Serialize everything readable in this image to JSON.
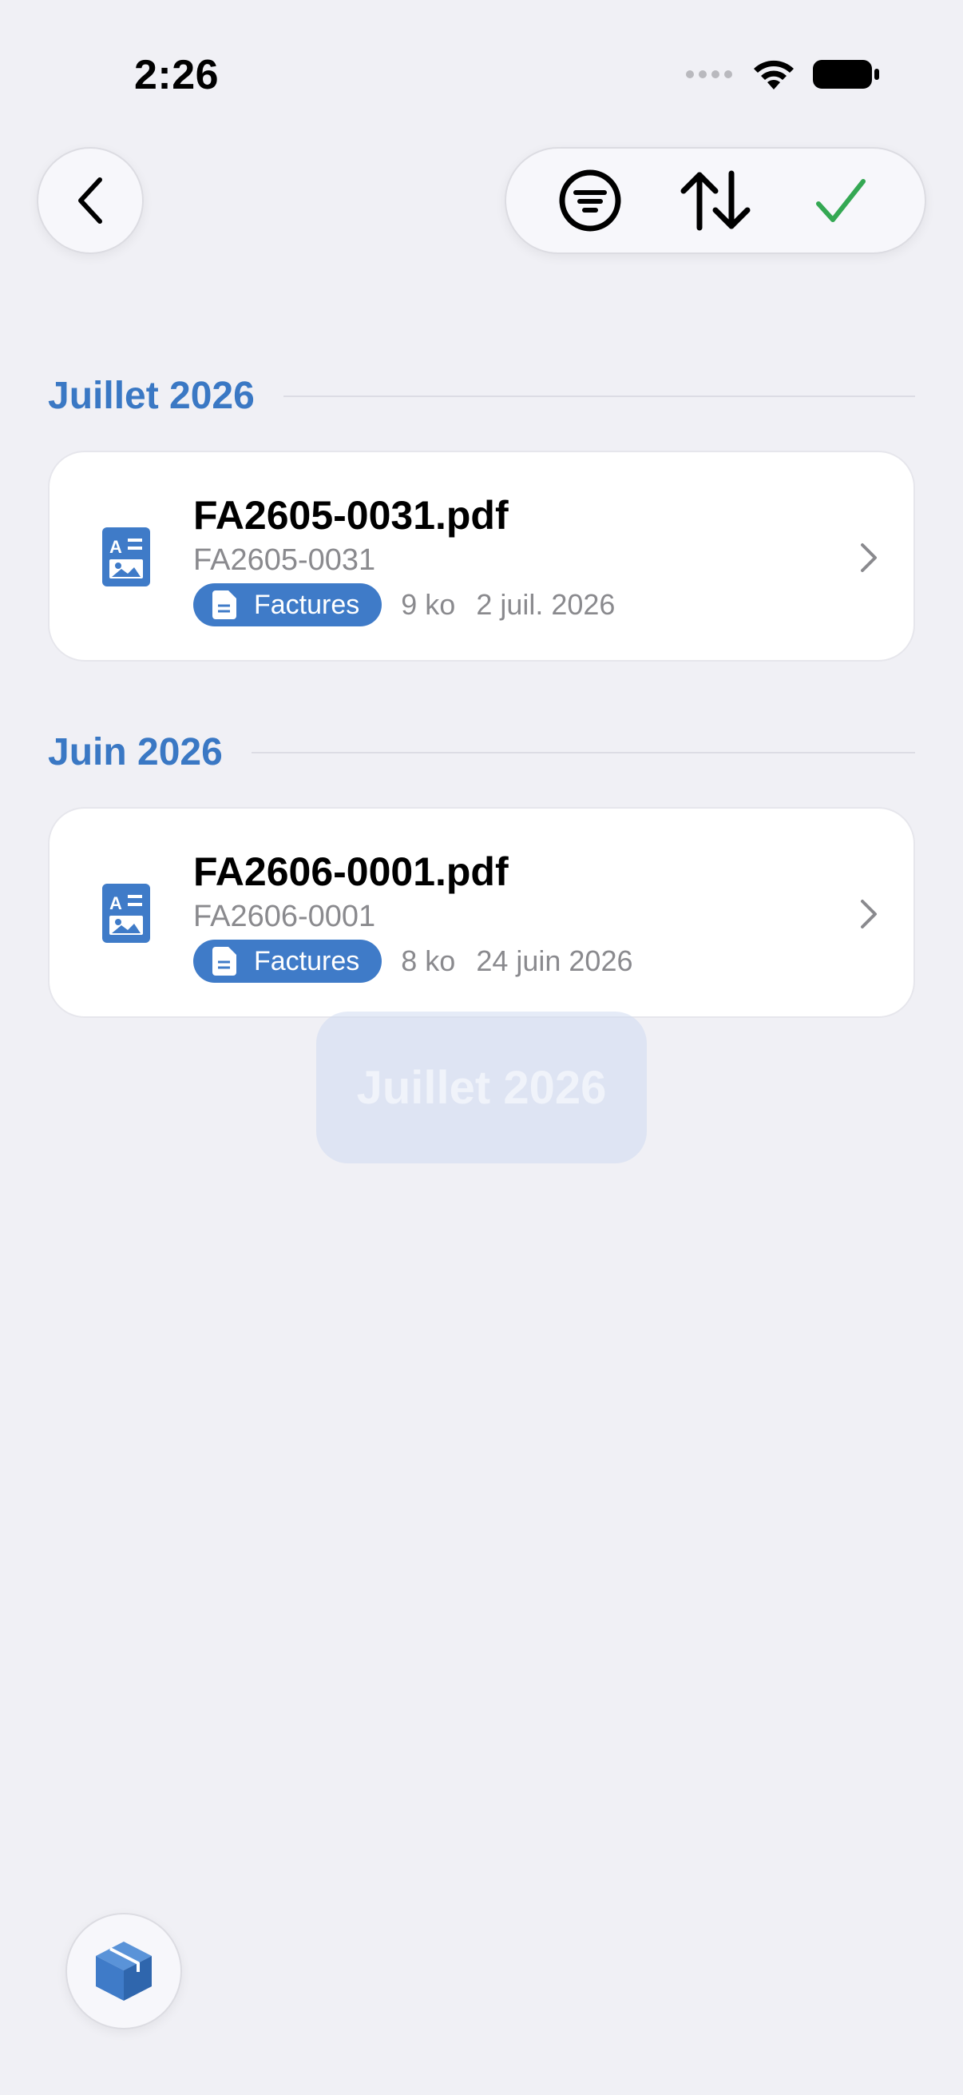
{
  "status_bar": {
    "time": "2:26"
  },
  "sections": [
    {
      "title": "Juillet 2026",
      "documents": [
        {
          "filename": "FA2605-0031.pdf",
          "reference": "FA2605-0031",
          "category": "Factures",
          "size": "9 ko",
          "date": "2 juil. 2026"
        }
      ]
    },
    {
      "title": "Juin 2026",
      "documents": [
        {
          "filename": "FA2606-0001.pdf",
          "reference": "FA2606-0001",
          "category": "Factures",
          "size": "8 ko",
          "date": "24 juin 2026"
        }
      ]
    }
  ],
  "scroll_indicator": {
    "label": "Juillet 2026"
  },
  "icons": {
    "back": "chevron-left-icon",
    "filter": "filter-icon",
    "sort": "sort-icon",
    "confirm": "checkmark-icon",
    "document": "document-image-icon",
    "category": "page-icon",
    "row_chevron": "chevron-right-icon",
    "fab": "cube-icon"
  },
  "colors": {
    "accent": "#3a78c4",
    "confirm": "#34a853",
    "badge": "#3f7bc8",
    "background": "#f0f0f5"
  }
}
